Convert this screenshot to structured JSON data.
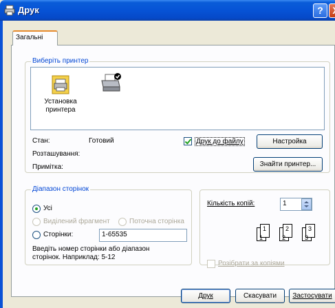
{
  "window": {
    "title": "Друк",
    "help_btn": "?",
    "close_btn": "X"
  },
  "tabs": [
    {
      "label": "Загальні"
    }
  ],
  "printer_group": {
    "title": "Виберіть принтер",
    "items": [
      {
        "label": "Установка принтера"
      },
      {
        "label": ""
      }
    ],
    "status_label": "Стан:",
    "status_value": "Готовий",
    "location_label": "Розташування:",
    "comment_label": "Примітка:",
    "print_to_file_label": "Друк до файлу",
    "print_to_file_checked": true,
    "settings_button": "Настройка",
    "find_printer_button": "Знайти принтер..."
  },
  "range_group": {
    "title": "Діапазон сторінок",
    "all_label": "Усі",
    "selection_label": "Виділений фрагмент",
    "current_page_label": "Поточна сторінка",
    "pages_label": "Сторінки:",
    "pages_value": "1-65535",
    "hint": "Введіть номер сторінки або діапазон сторінок. Наприклад: 5-12"
  },
  "copies_group": {
    "copies_label": "Кількість копій:",
    "copies_value": "1",
    "collate_label": "Розібрати за копіями",
    "page_numbers": [
      "1",
      "1",
      "2",
      "2",
      "3",
      "3"
    ]
  },
  "buttons": {
    "print": "Друк",
    "cancel": "Скасувати",
    "apply": "Застосувати"
  }
}
